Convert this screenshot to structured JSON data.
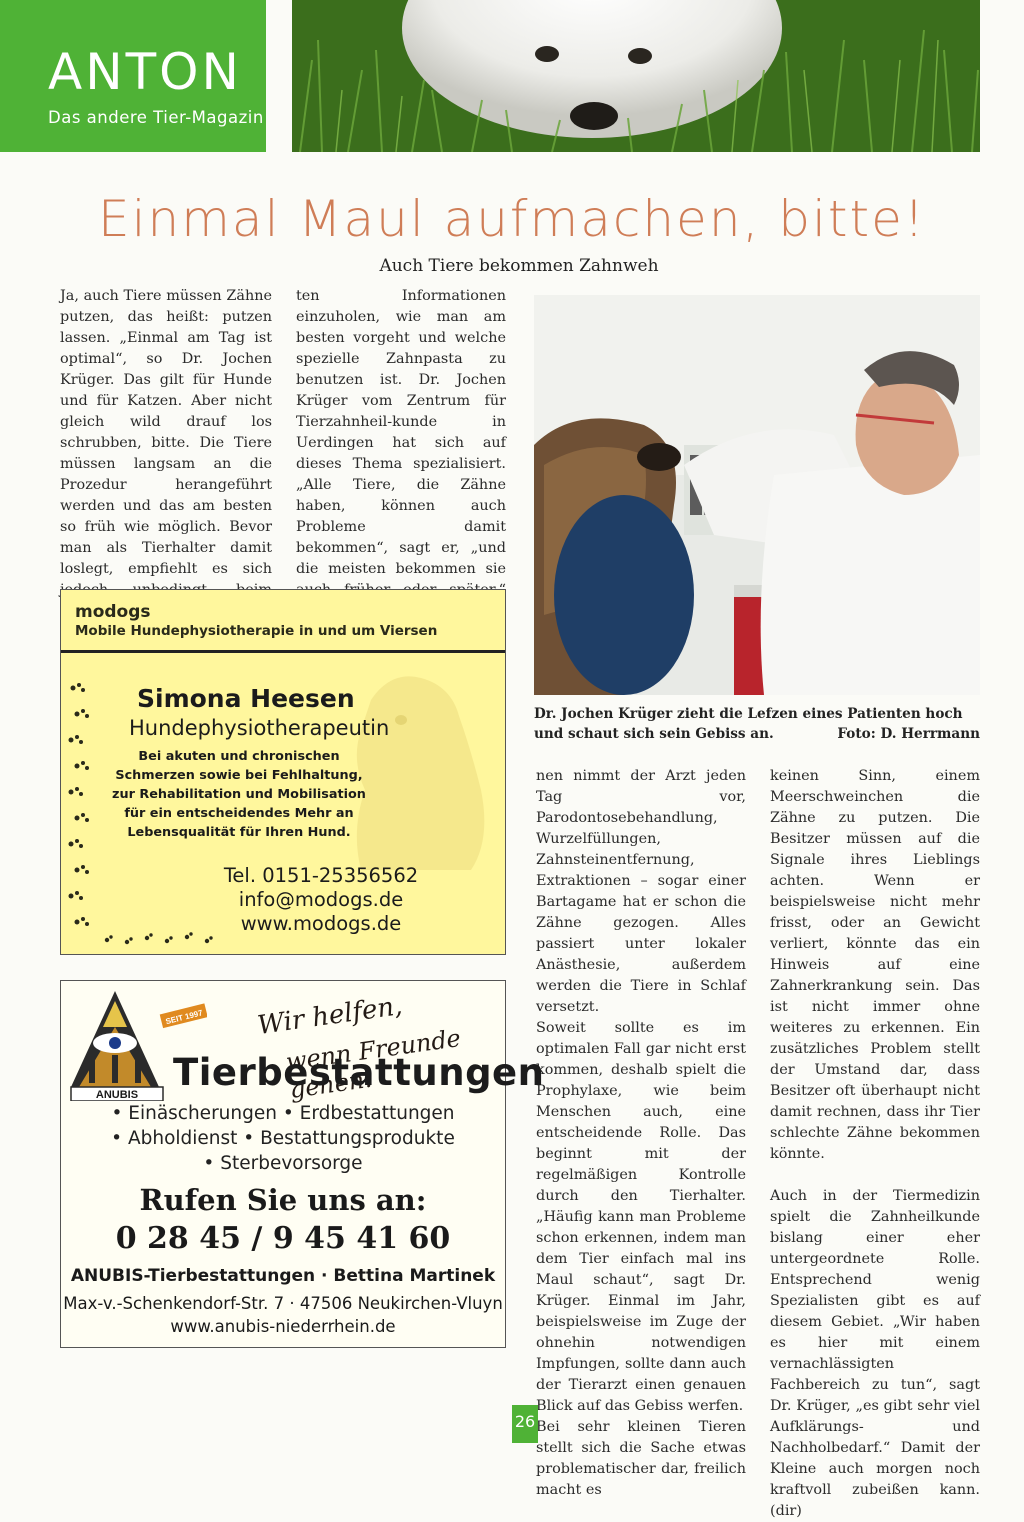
{
  "masthead": {
    "name": "ANTON",
    "tagline": "Das andere Tier-Magazin",
    "brand_color": "#4fb236"
  },
  "article": {
    "headline": "Einmal Maul aufmachen, bitte!",
    "headline_color": "#cf7d57",
    "subheadline": "Auch Tiere bekommen Zahnweh",
    "col_a1": [
      "Ja, auch Tiere müssen Zähne putzen, das heißt: putzen lassen. „Einmal am Tag ist optimal“, so Dr. Jochen Krüger. Das gilt für Hunde und für Katzen. Aber nicht gleich wild drauf los schrubben, bitte. Die Tiere müssen langsam an die Prozedur herangeführt werden und das am besten so früh wie möglich. Bevor man als Tierhalter damit loslegt, empfiehlt es sich jedoch unbedingt, beim Exper-"
    ],
    "col_a2": [
      "ten Informationen einzuholen, wie man am besten vorgeht und welche spezielle Zahnpasta zu benutzen ist. Dr. Jochen Krüger vom Zentrum für Tierzahnheil-kunde in Uerdingen hat sich auf dieses Thema spezialisiert. „Alle Tiere, die Zähne haben, können auch Probleme damit bekommen“, sagt er, „und die meisten bekommen sie auch früher oder später.“ Durchschnittlich vier Operatio-"
    ],
    "col_b1": [
      "nen nimmt der Arzt jeden Tag vor, Parodontosebehandlung, Wurzelfüllungen, Zahnsteinentfernung, Extraktionen – sogar einer Bartagame hat er schon die Zähne gezogen. Alles passiert unter lokaler Anästhesie, außerdem werden die Tiere in Schlaf versetzt.",
      "Soweit sollte es im optimalen Fall gar nicht erst kommen, deshalb spielt die Prophylaxe, wie beim Menschen auch, eine entscheidende Rolle. Das beginnt mit der regelmäßigen Kontrolle durch den Tierhalter. „Häufig kann man Probleme schon erkennen, indem man dem Tier einfach mal ins Maul schaut“, sagt Dr. Krüger. Einmal im Jahr, beispielsweise im Zuge der ohnehin notwendigen Impfungen, sollte dann auch der Tierarzt einen genauen Blick auf das Gebiss werfen.",
      "Bei sehr kleinen Tieren stellt sich die Sache etwas problematischer dar, freilich macht es"
    ],
    "col_b2": [
      "keinen Sinn, einem Meerschweinchen die Zähne zu putzen. Die Besitzer müssen auf die Signale ihres Lieblings achten. Wenn er beispielsweise nicht mehr frisst, oder an Gewicht verliert, könnte das ein Hinweis auf eine Zahnerkrankung sein. Das ist nicht immer ohne weiteres zu erkennen. Ein zusätzliches Problem stellt der Umstand dar, dass Besitzer oft überhaupt nicht damit rechnen, dass ihr Tier schlechte Zähne bekommen könnte.",
      "Auch in der Tiermedizin spielt die Zahnheilkunde bislang einer eher untergeordnete Rolle. Entsprechend wenig Spezialisten gibt es auf diesem Gebiet. „Wir haben es hier mit einem vernachlässigten Fachbereich zu tun“, sagt Dr. Krüger, „es gibt sehr viel Aufklärungs- und Nachholbedarf.“ Damit der Kleine auch morgen noch kraftvoll zubeißen kann. (dir)"
    ],
    "photo_caption": "Dr. Jochen Krüger zieht die Lefzen eines Patienten hoch und schaut sich sein Gebiss an.",
    "photo_credit": "Foto: D. Herrmann"
  },
  "ad_modogs": {
    "brand": "modogs",
    "tagline": "Mobile Hundephysiotherapie in und um Viersen",
    "person": "Simona Heesen",
    "role": "Hundephysiotherapeutin",
    "description_lines": [
      "Bei akuten und chronischen",
      "Schmerzen sowie bei Fehlhaltung,",
      "zur Rehabilitation und Mobilisation",
      "für ein entscheidendes Mehr an",
      "Lebensqualität für Ihren Hund."
    ],
    "tel": "Tel. 0151-25356562",
    "email": "info@modogs.de",
    "web": "www.modogs.de",
    "background": "#fff79d"
  },
  "ad_anubis": {
    "badge": "SEIT 1997",
    "logo_text": "ANUBIS",
    "slogan_1": "Wir helfen,",
    "slogan_2": "wenn Freunde gehen.",
    "title": "Tierbestattungen",
    "services": [
      "• Einäscherungen • Erdbestattungen",
      "• Abholdienst • Bestattungsprodukte",
      "• Sterbevorsorge"
    ],
    "call": "Rufen Sie uns an:",
    "phone": "0 28 45 / 9 45 41 60",
    "company": "ANUBIS-Tierbestattungen · Bettina Martinek",
    "address": "Max-v.-Schenkendorf-Str. 7 · 47506 Neukirchen-Vluyn",
    "web": "www.anubis-niederrhein.de"
  },
  "page_number": "26"
}
